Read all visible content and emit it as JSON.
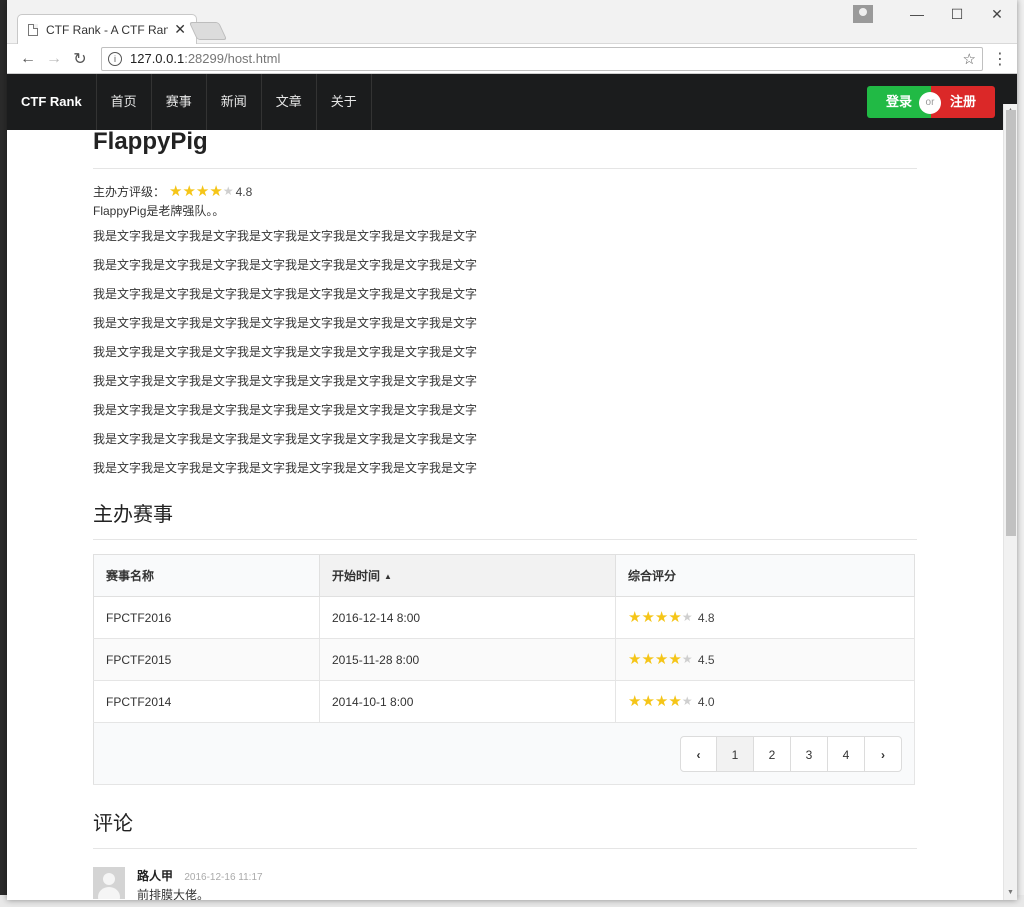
{
  "browser": {
    "tab_title": "CTF Rank - A CTF Rank",
    "url_host": "127.0.0.1",
    "url_path": ":28299/host.html"
  },
  "navbar": {
    "brand": "CTF Rank",
    "items": [
      "首页",
      "赛事",
      "新闻",
      "文章",
      "关于"
    ],
    "login": "登录",
    "or": "or",
    "register": "注册"
  },
  "host": {
    "name": "FlappyPig",
    "rating_label": "主办方评级：",
    "rating": 4.8,
    "rating_text": "4.8",
    "stars_filled": 4,
    "description": "FlappyPig是老牌强队。。",
    "paragraphs": [
      "我是文字我是文字我是文字我是文字我是文字我是文字我是文字我是文字",
      "我是文字我是文字我是文字我是文字我是文字我是文字我是文字我是文字",
      "我是文字我是文字我是文字我是文字我是文字我是文字我是文字我是文字",
      "我是文字我是文字我是文字我是文字我是文字我是文字我是文字我是文字",
      "我是文字我是文字我是文字我是文字我是文字我是文字我是文字我是文字",
      "我是文字我是文字我是文字我是文字我是文字我是文字我是文字我是文字",
      "我是文字我是文字我是文字我是文字我是文字我是文字我是文字我是文字",
      "我是文字我是文字我是文字我是文字我是文字我是文字我是文字我是文字",
      "我是文字我是文字我是文字我是文字我是文字我是文字我是文字我是文字"
    ]
  },
  "events": {
    "title": "主办赛事",
    "columns": [
      "赛事名称",
      "开始时间",
      "综合评分"
    ],
    "rows": [
      {
        "name": "FPCTF2016",
        "start": "2016-12-14 8:00",
        "score": "4.8",
        "stars": 4
      },
      {
        "name": "FPCTF2015",
        "start": "2015-11-28 8:00",
        "score": "4.5",
        "stars": 4
      },
      {
        "name": "FPCTF2014",
        "start": "2014-10-1 8:00",
        "score": "4.0",
        "stars": 4
      }
    ],
    "pagination": {
      "prev": "‹",
      "pages": [
        "1",
        "2",
        "3",
        "4"
      ],
      "next": "›",
      "current": "1"
    }
  },
  "comments": {
    "title": "评论",
    "items": [
      {
        "author": "路人甲",
        "time": "2016-12-16 11:17",
        "text": "前排膜大佬。"
      }
    ]
  },
  "colors": {
    "navbar_bg": "#1b1c1d",
    "login_green": "#21ba45",
    "register_red": "#db2828",
    "star_yellow": "#f5c518"
  }
}
